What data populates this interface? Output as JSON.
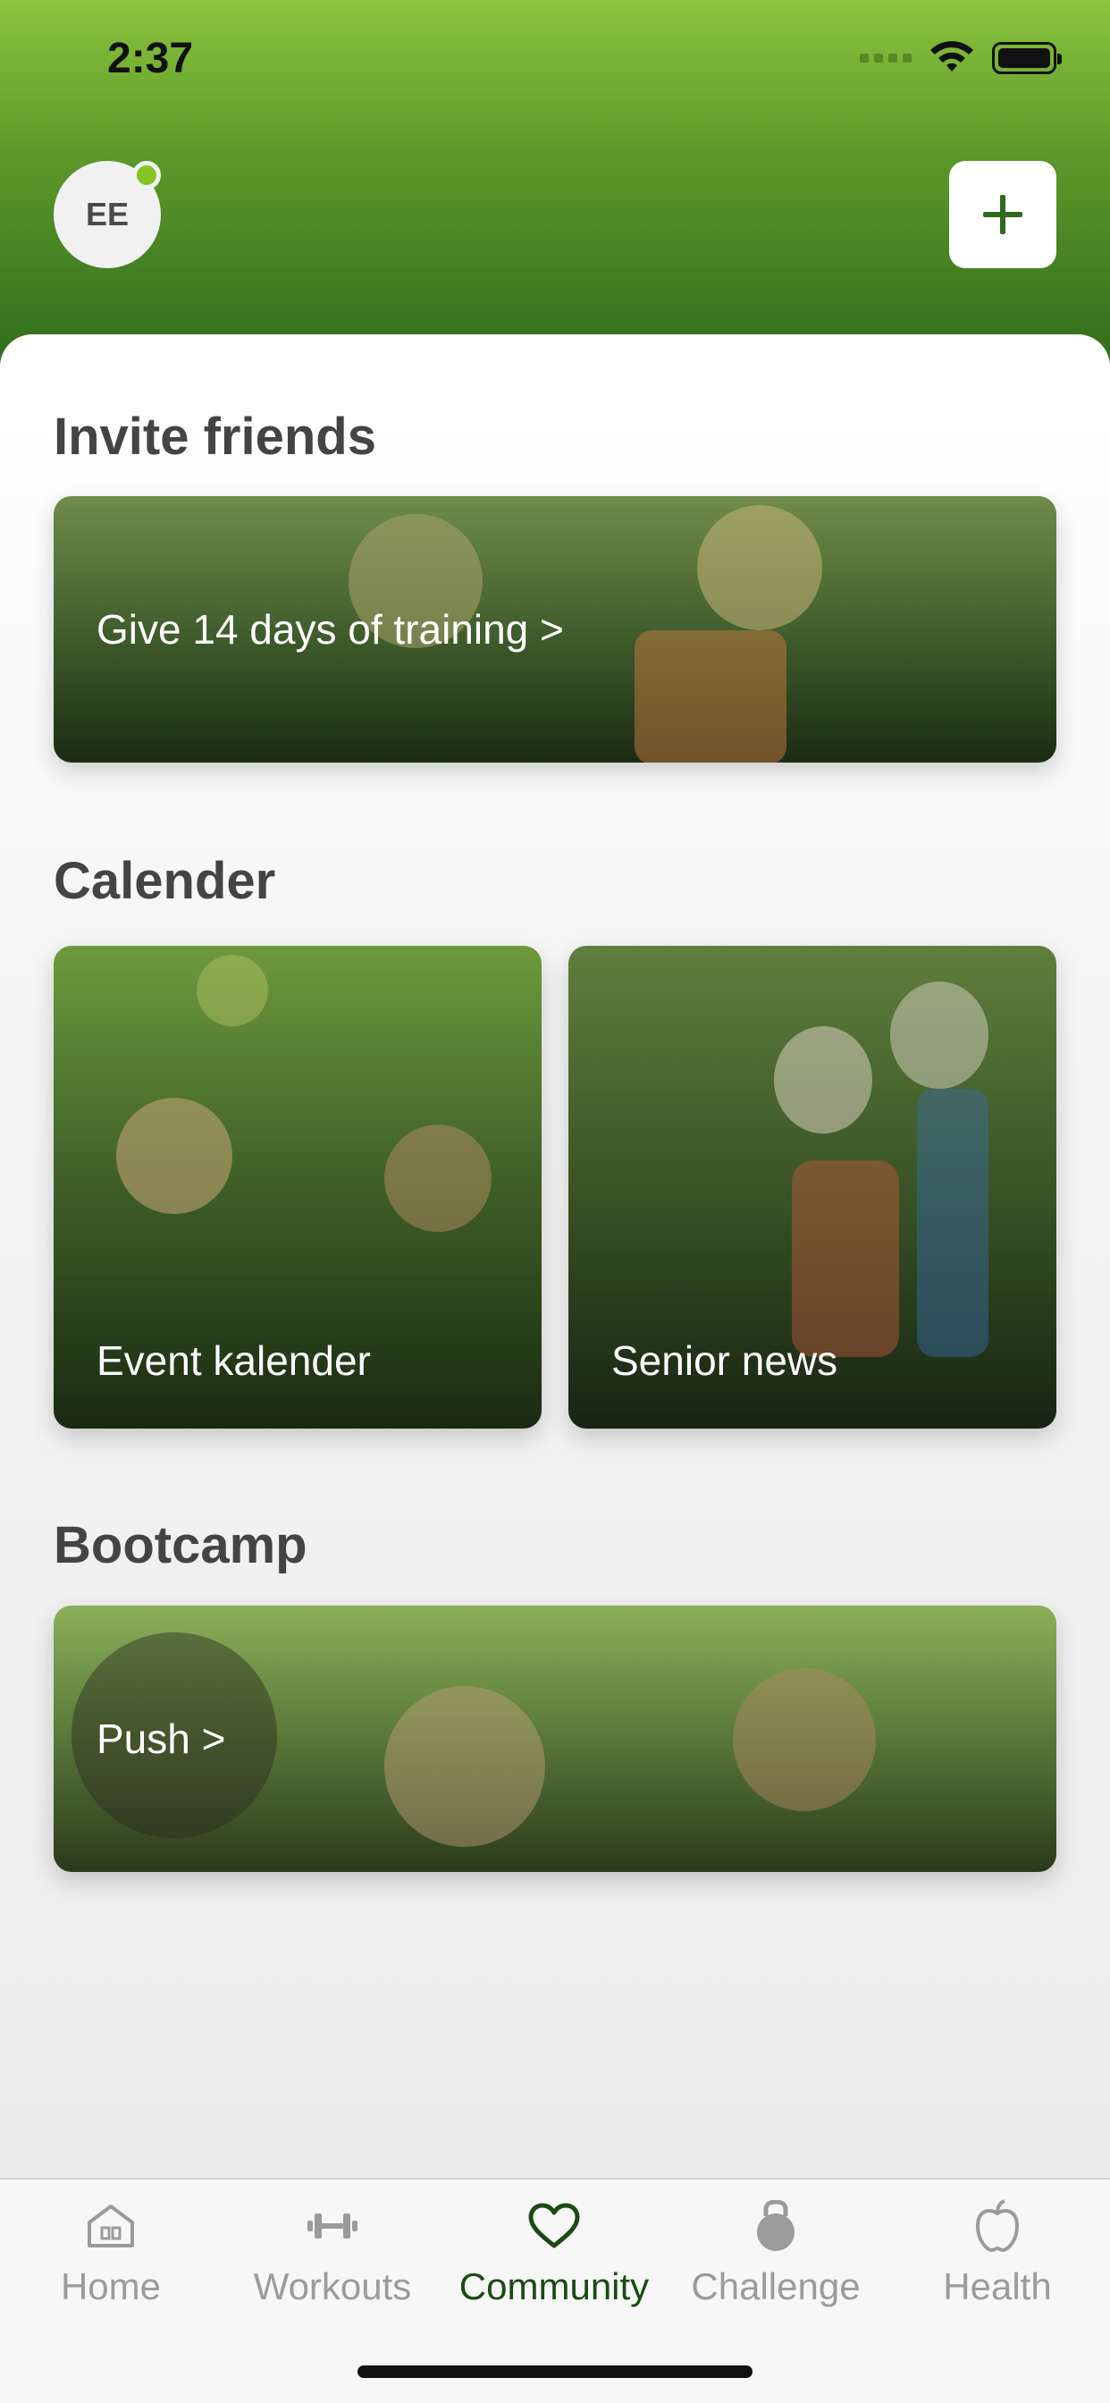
{
  "status_bar": {
    "time": "2:37"
  },
  "header": {
    "avatar_initials": "EE",
    "add_label": "+"
  },
  "sections": {
    "invite": {
      "title": "Invite friends",
      "card_label": "Give 14 days of training >"
    },
    "calendar": {
      "title": "Calender",
      "cards": [
        {
          "label": "Event kalender"
        },
        {
          "label": "Senior news"
        }
      ]
    },
    "bootcamp": {
      "title": "Bootcamp",
      "card_label": "Push >"
    }
  },
  "tabbar": {
    "active": "Community",
    "items": [
      {
        "label": "Home",
        "icon": "home-icon"
      },
      {
        "label": "Workouts",
        "icon": "dumbbell-icon"
      },
      {
        "label": "Community",
        "icon": "heart-icon"
      },
      {
        "label": "Challenge",
        "icon": "kettlebell-icon"
      },
      {
        "label": "Health",
        "icon": "apple-icon"
      }
    ]
  },
  "colors": {
    "header_top": "#8cc43e",
    "header_bottom": "#2f6a1c",
    "accent": "#86c324",
    "active_tab": "#1b4a14",
    "inactive_tab": "#9b9b9b"
  }
}
